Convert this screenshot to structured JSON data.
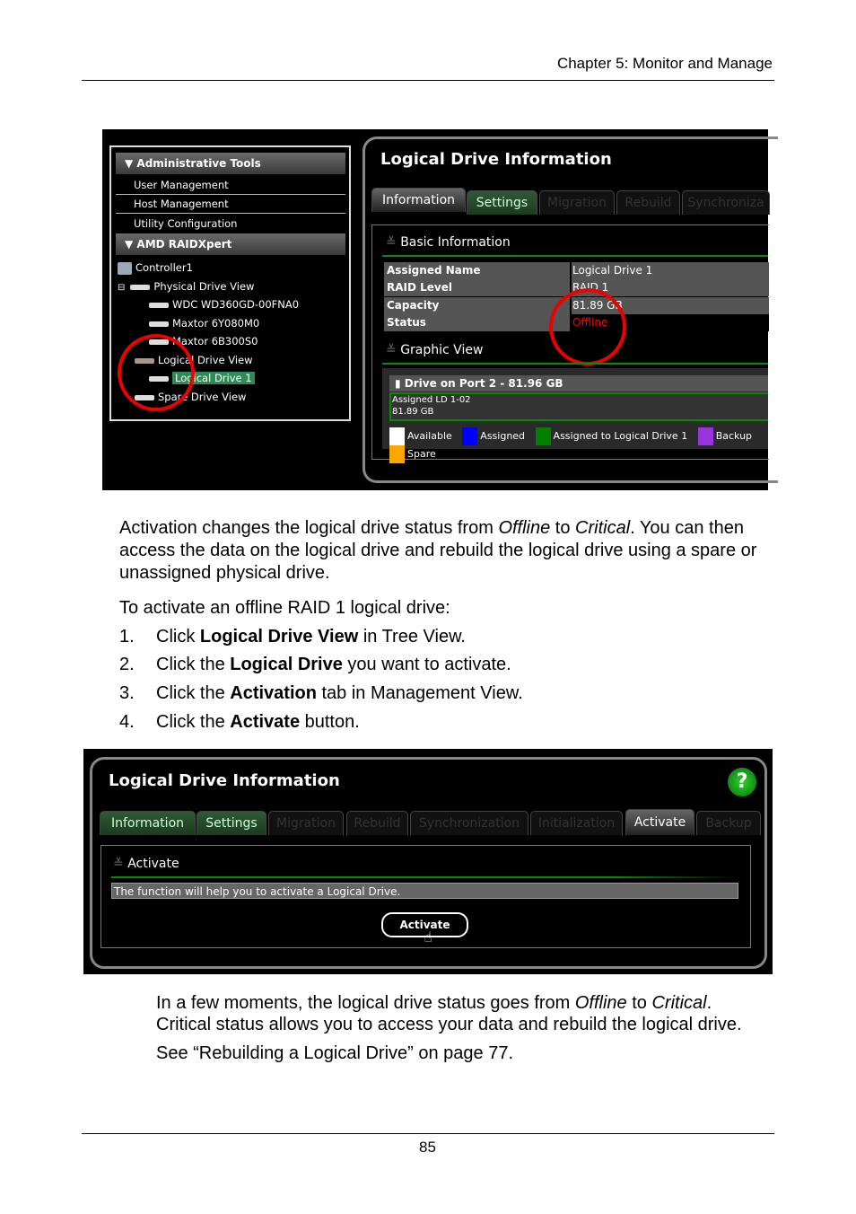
{
  "header": {
    "chapter": "Chapter 5: Monitor and Manage"
  },
  "screenshot1": {
    "sidebar": {
      "admin_header": "▼ Administrative Tools",
      "admin_items": [
        "User Management",
        "Host Management",
        "Utility Configuration"
      ],
      "raid_header": "▼ AMD RAIDXpert",
      "tree": [
        "Controller1",
        "Physical Drive View",
        "WDC WD360GD-00FNA0",
        "Maxtor 6Y080M0",
        "Maxtor 6B300S0",
        "Logical Drive View",
        "Logical Drive 1",
        "Spare Drive View"
      ]
    },
    "main": {
      "title": "Logical Drive Information",
      "tabs": [
        "Information",
        "Settings",
        "Migration",
        "Rebuild",
        "Synchroniza"
      ],
      "basic_info_header": "Basic Information",
      "rows": [
        {
          "label": "Assigned Name",
          "value": "Logical Drive 1"
        },
        {
          "label": "RAID Level",
          "value": "RAID 1"
        },
        {
          "label": "Capacity",
          "value": "81.89 GB"
        },
        {
          "label": "Status",
          "value": "Offline"
        }
      ],
      "graphic_view_header": "Graphic View",
      "drive_header": "Drive on Port 2 - 81.96 GB",
      "assigned_line1": "Assigned LD 1-02",
      "assigned_line2": "81.89 GB",
      "legend": [
        {
          "label": "Available",
          "color": "#ffffff"
        },
        {
          "label": "Assigned",
          "color": "#0000ff"
        },
        {
          "label": "Assigned to Logical Drive 1",
          "color": "#008000"
        },
        {
          "label": "Backup",
          "color": "#9933dd"
        },
        {
          "label": "Spare",
          "color": "#ffa500"
        }
      ]
    },
    "status_color": "#ff0000"
  },
  "text": {
    "p1_l1_a": "Activation changes the logical drive status from ",
    "p1_l1_b": "Offline",
    "p1_l1_c": " to ",
    "p1_l1_d": "Critical",
    "p1_l1_e": ". You can then",
    "p1_l2": "access the data on the logical drive and rebuild the logical drive using a spare or",
    "p1_l3": "unassigned physical drive.",
    "p2": "To activate an offline RAID 1 logical drive:",
    "steps": [
      {
        "num": "1.",
        "a": "Click ",
        "b": "Logical Drive View",
        "c": " in Tree View."
      },
      {
        "num": "2.",
        "a": "Click the ",
        "b": "Logical Drive",
        "c": " you want to activate."
      },
      {
        "num": "3.",
        "a": "Click the ",
        "b": "Activation",
        "c": " tab in Management View."
      },
      {
        "num": "4.",
        "a": "Click the ",
        "b": "Activate",
        "c": " button."
      }
    ],
    "p3_l1_a": "In a few moments, the logical drive status goes from ",
    "p3_l1_b": "Offline",
    "p3_l1_c": " to ",
    "p3_l1_d": "Critical",
    "p3_l1_e": ".",
    "p3_l2": "Critical status allows you to access your data and rebuild the logical drive.",
    "p4": "See “Rebuilding a Logical Drive” on page 77."
  },
  "screenshot2": {
    "title": "Logical Drive Information",
    "help": "?",
    "tabs": [
      "Information",
      "Settings",
      "Migration",
      "Rebuild",
      "Synchronization",
      "Initialization",
      "Activate",
      "Backup"
    ],
    "section": "Activate",
    "description": "The function will help you to activate a Logical Drive.",
    "button": "Activate"
  },
  "footer": {
    "page": "85"
  },
  "colors": {
    "tab_green": "#2f5a34",
    "accent_green": "#0a8a0a",
    "help_green": "#1a9a1a"
  }
}
